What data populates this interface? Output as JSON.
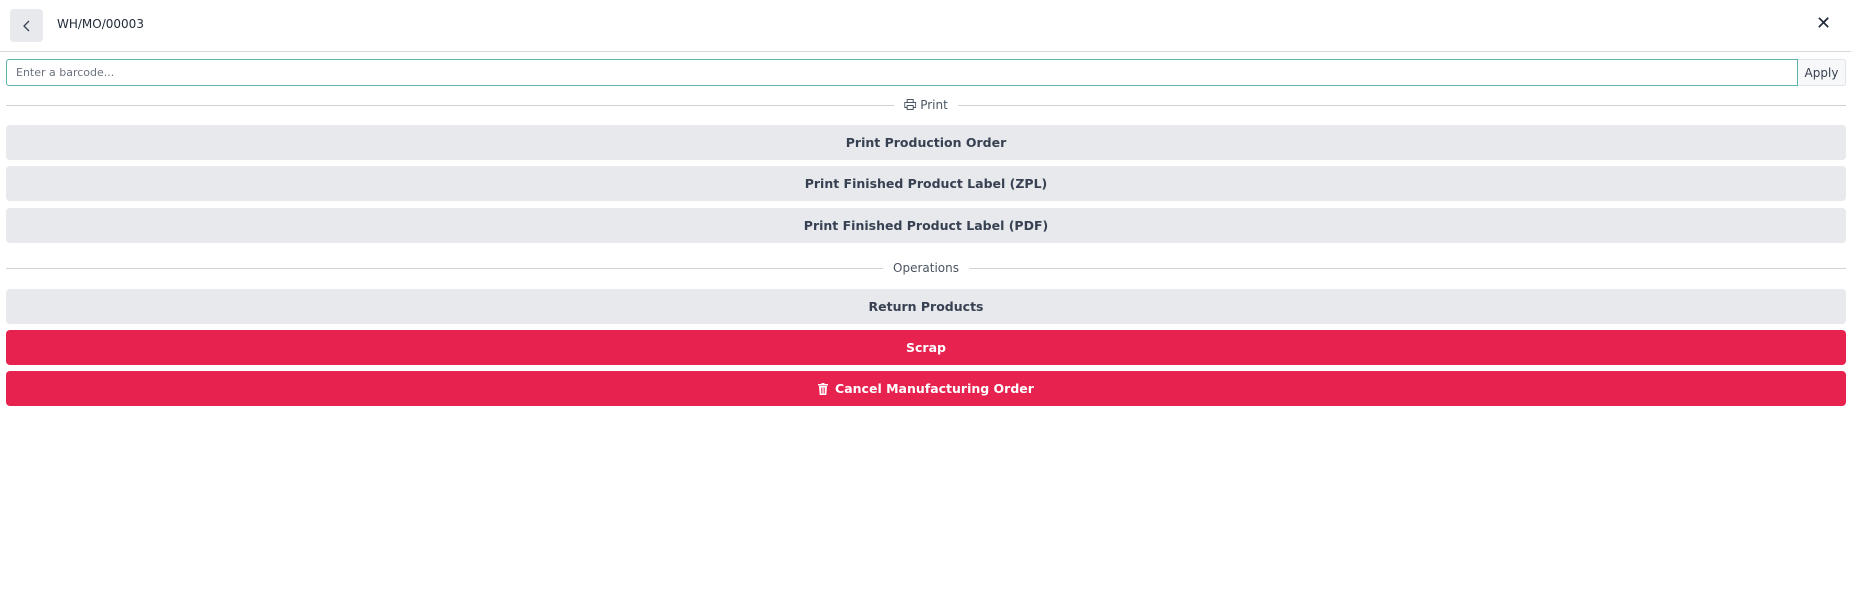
{
  "header": {
    "title": "WH/MO/00003",
    "back_icon": "chevron-left-icon",
    "close_icon": "close-icon"
  },
  "barcode": {
    "placeholder": "Enter a barcode...",
    "value": "",
    "apply_label": "Apply"
  },
  "sections": {
    "print": {
      "label": "Print",
      "icon": "printer-icon",
      "buttons": [
        "Print Production Order",
        "Print Finished Product Label (ZPL)",
        "Print Finished Product Label (PDF)"
      ]
    },
    "operations": {
      "label": "Operations",
      "return_label": "Return Products",
      "scrap_label": "Scrap",
      "cancel_label": "Cancel Manufacturing Order",
      "cancel_icon": "trash-icon"
    }
  },
  "colors": {
    "danger": "#e8224f",
    "secondary": "#e7e9ed",
    "accent": "#5fb3ad"
  }
}
